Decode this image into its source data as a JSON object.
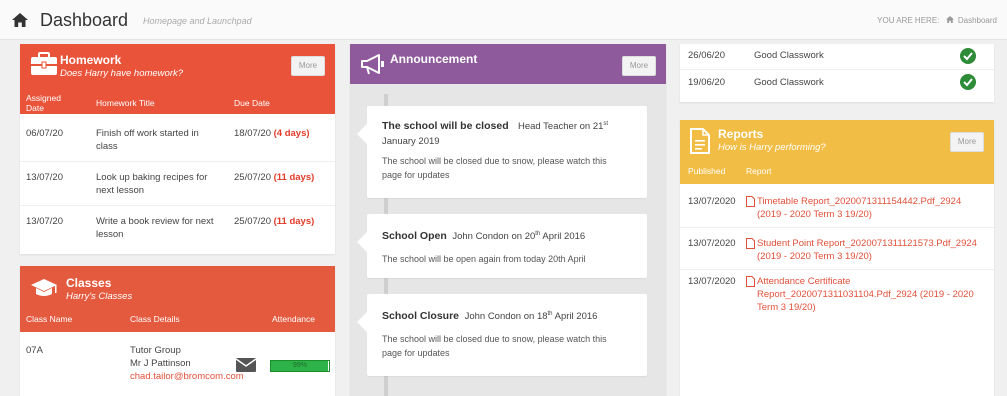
{
  "topbar": {
    "title": "Dashboard",
    "subtitle": "Homepage and Launchpad",
    "breadcrumb_prefix": "YOU ARE HERE:",
    "breadcrumb_item": "Dashboard"
  },
  "homework": {
    "title": "Homework",
    "subtitle": "Does Harry have homework?",
    "more": "More",
    "columns": [
      "Assigned Date",
      "Homework Title",
      "Due Date"
    ],
    "rows": [
      {
        "assigned": "06/07/20",
        "title": "Finish off work started in class",
        "due": "18/07/20",
        "days": "(4 days)"
      },
      {
        "assigned": "13/07/20",
        "title": "Look up baking recipes for next lesson",
        "due": "25/07/20",
        "days": "(11 days)"
      },
      {
        "assigned": "13/07/20",
        "title": "Write a book review for next lesson",
        "due": "25/07/20",
        "days": "(11 days)"
      }
    ]
  },
  "classes": {
    "title": "Classes",
    "subtitle": "Harry's Classes",
    "columns": [
      "Class Name",
      "Class Details",
      "Attendance"
    ],
    "rows": [
      {
        "name": "07A",
        "detail1": "Tutor Group",
        "detail2": "Mr J Pattinson",
        "email": "chad.tailor@bromcom.com",
        "attendance_label": "99%",
        "attendance_fraction": 0.99
      }
    ]
  },
  "announcement": {
    "title": "Announcement",
    "more": "More",
    "items": [
      {
        "title": "The school will be closed",
        "meta_a": "Head Teacher on 21",
        "meta_sup": "st",
        "meta_b": "January 2019",
        "body": "The school will be closed due to snow, please watch this page for updates"
      },
      {
        "title": "School Open",
        "meta_a": "John Condon on 20",
        "meta_sup": "th",
        "meta_b": "April 2016",
        "body": "The school will be open again from today 20th April"
      },
      {
        "title": "School Closure",
        "meta_a": "John Condon on 18",
        "meta_sup": "th",
        "meta_b": "April 2016",
        "body": "The school will be closed due to snow, please watch this page for updates"
      }
    ]
  },
  "achievements": {
    "rows": [
      {
        "date": "26/06/20",
        "label": "Good Classwork"
      },
      {
        "date": "19/06/20",
        "label": "Good Classwork"
      }
    ]
  },
  "reports": {
    "title": "Reports",
    "subtitle": "How is Harry performing?",
    "more": "More",
    "columns": [
      "Published",
      "Report"
    ],
    "rows": [
      {
        "date": "13/07/2020",
        "line1": "Timetable Report_2020071311154442.Pdf_2924",
        "line2": "(2019 - 2020 Term 3 19/20)"
      },
      {
        "date": "13/07/2020",
        "line1": "Student Point Report_2020071311121573.Pdf_2924",
        "line2": "(2019 - 2020 Term 3 19/20)"
      },
      {
        "date": "13/07/2020",
        "line1": "Attendance Certificate",
        "line2": "Report_2020071311031104.Pdf_2924 (2019 - 2020",
        "line3": "Term 3 19/20)"
      }
    ]
  },
  "colors": {
    "red": "#e8533a",
    "purple": "#8e5a9b",
    "yellow": "#f1bd44",
    "green": "#2db34a"
  }
}
